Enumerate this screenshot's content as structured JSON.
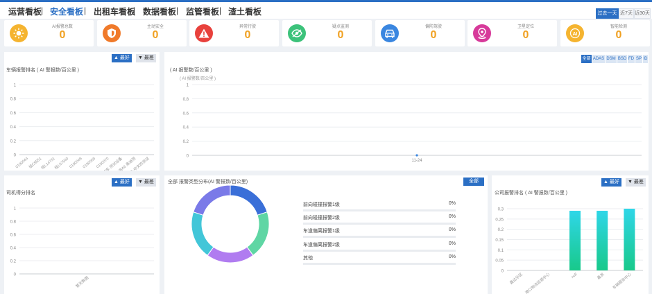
{
  "nav": {
    "tabs": [
      "运营看板",
      "安全看板",
      "出租车看板",
      "数据看板",
      "监管看板",
      "渣土看板"
    ],
    "active_index": 1,
    "ranges": [
      "过去一天",
      "近7天",
      "近30天"
    ],
    "active_range": 0
  },
  "stats": [
    {
      "label": "AI报警总数",
      "value": "0",
      "color": "#f5b430",
      "icon": "sun-icon"
    },
    {
      "label": "主动安全",
      "value": "0",
      "color": "#f07a2a",
      "icon": "shield-icon"
    },
    {
      "label": "异常行驶",
      "value": "0",
      "color": "#e8413c",
      "icon": "warning-icon"
    },
    {
      "label": "疑点监测",
      "value": "0",
      "color": "#3cc27a",
      "icon": "eye-off-icon"
    },
    {
      "label": "偏防驾驶",
      "value": "0",
      "color": "#3a86e0",
      "icon": "car-icon"
    },
    {
      "label": "卫星定位",
      "value": "0",
      "color": "#d73a9a",
      "icon": "location-icon"
    },
    {
      "label": "智能检测",
      "value": "0",
      "color": "#f5b430",
      "icon": "ai-icon"
    }
  ],
  "buttons": {
    "best": "最好",
    "worst": "最差",
    "all": "全部"
  },
  "vehicle_panel": {
    "title": "车辆报警排名 ( AI 警报数/百公里 )"
  },
  "trend_panel": {
    "title": "( AI 报警数/百公里 )",
    "unit": "( AI 报警数/百公里 )",
    "filters": [
      "全部",
      "ADAS",
      "DSM",
      "BSD",
      "FD",
      "SP",
      "ID"
    ],
    "active_filter": 0
  },
  "driver_panel": {
    "title": "司机得分排名"
  },
  "type_panel": {
    "title": "全部 报警类型分布(AI 警报数/百公里)",
    "items": [
      {
        "name": "前向碰撞报警1级",
        "value": "0%"
      },
      {
        "name": "前向碰撞报警2级",
        "value": "0%"
      },
      {
        "name": "车道偏离报警1级",
        "value": "0%"
      },
      {
        "name": "车道偏离报警2级",
        "value": "0%"
      },
      {
        "name": "其他",
        "value": "0%"
      }
    ],
    "ring_colors": [
      "#3a6fd8",
      "#5fd6a4",
      "#b07cf0",
      "#42c6d8",
      "#7a7ae8"
    ]
  },
  "company_panel": {
    "title": "公司报警排名 ( AI 警报数/百公里 )"
  },
  "chart_data": [
    {
      "type": "bar",
      "categories": [
        "0190044",
        "桂C5551",
        "桂L14731",
        "桂L07540",
        "0190048",
        "0190069",
        "0190070",
        "测试车 测试设备",
        "奥迪A6 奥迪测",
        "测试-中文的测试"
      ],
      "values": [
        0,
        0,
        0,
        0,
        0,
        0,
        0,
        0,
        0,
        0
      ],
      "yticks": [
        "1",
        "0.8",
        "0.6",
        "0.4",
        "0.2",
        "0"
      ],
      "ylim": [
        0,
        1
      ]
    },
    {
      "type": "line",
      "x": [
        "11-24"
      ],
      "values": [
        0
      ],
      "yticks": [
        "1",
        "0.8",
        "0.6",
        "0.4",
        "0.2",
        "0"
      ],
      "ylim": [
        0,
        1
      ]
    },
    {
      "type": "bar",
      "categories": [
        "暂无数据"
      ],
      "values": [
        0
      ],
      "yticks": [
        "1",
        "0.8",
        "0.6",
        "0.4",
        "0.2",
        "0"
      ],
      "ylim": [
        0,
        1
      ]
    },
    {
      "type": "pie",
      "categories": [
        "前向碰撞报警1级",
        "前向碰撞报警2级",
        "车道偏离报警1级",
        "车道偏离报警2级",
        "其他"
      ],
      "values": [
        0,
        0,
        0,
        0,
        0
      ]
    },
    {
      "type": "bar",
      "categories": [
        "鑫达华区",
        "港口物流运营中心",
        "null",
        "鑫发",
        "车辆服务中心"
      ],
      "values": [
        0,
        0,
        0.29,
        0.29,
        0.3
      ],
      "yticks": [
        "0.3",
        "0.25",
        "0.2",
        "0.15",
        "0.1",
        "0.05",
        "0"
      ],
      "ylim": [
        0,
        0.3
      ]
    }
  ]
}
